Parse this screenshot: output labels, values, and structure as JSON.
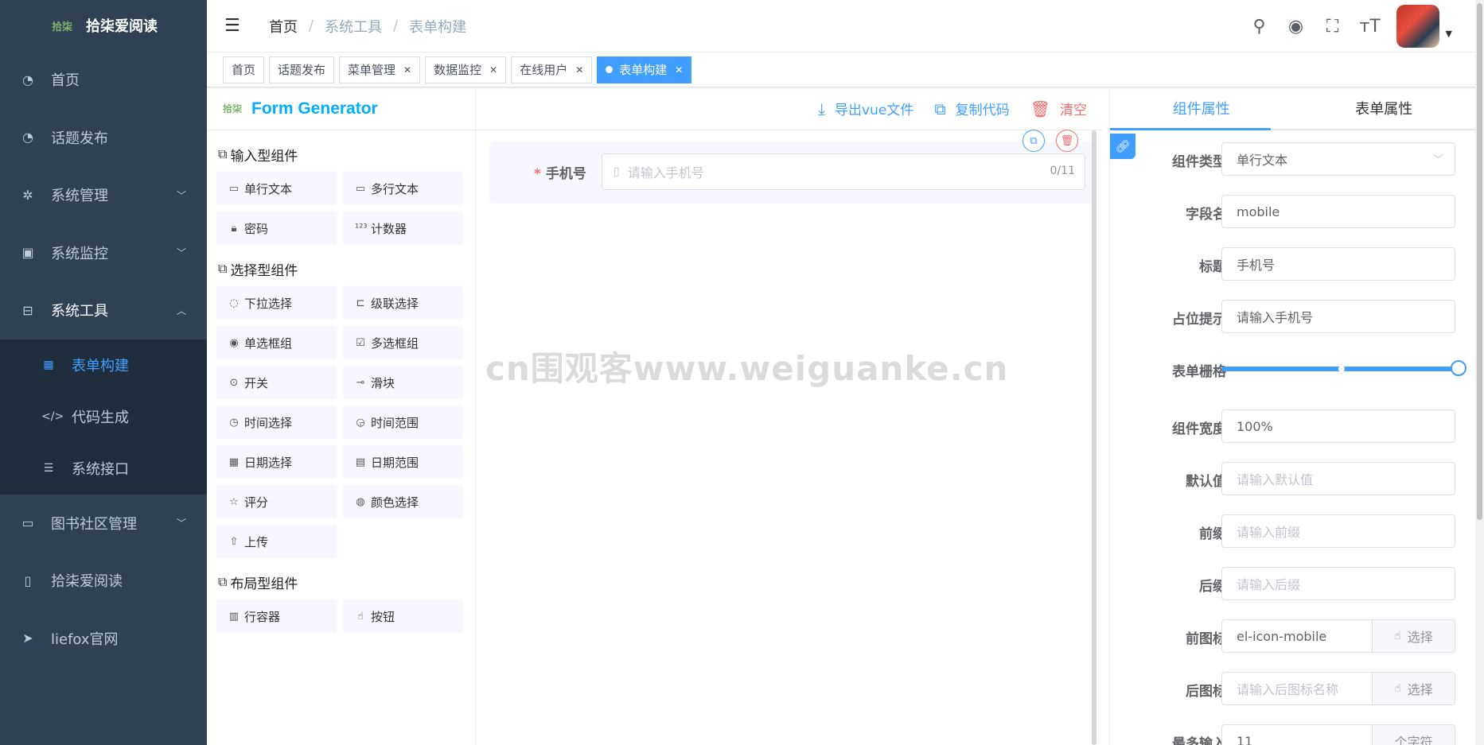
{
  "app": {
    "logo_mark": "拾柒",
    "title": "拾柒爱阅读"
  },
  "sidebar": {
    "items": [
      {
        "label": "首页",
        "icon": "dashboard-icon"
      },
      {
        "label": "话题发布",
        "icon": "dashboard-icon"
      },
      {
        "label": "系统管理",
        "icon": "gear-icon",
        "arrow": "﹀"
      },
      {
        "label": "系统监控",
        "icon": "monitor-icon",
        "arrow": "﹀"
      },
      {
        "label": "系统工具",
        "icon": "toolbox-icon",
        "arrow": "︿"
      }
    ],
    "submenu": [
      {
        "label": "表单构建",
        "icon": "table-icon",
        "active": true
      },
      {
        "label": "代码生成",
        "icon": "code-icon"
      },
      {
        "label": "系统接口",
        "icon": "sliders-icon"
      }
    ],
    "items_after": [
      {
        "label": "图书社区管理",
        "icon": "presentation-icon",
        "arrow": "﹀"
      },
      {
        "label": "拾柒爱阅读",
        "icon": "book-icon"
      },
      {
        "label": "liefox官网",
        "icon": "paper-plane-icon"
      }
    ]
  },
  "navbar": {
    "breadcrumb": [
      "首页",
      "系统工具",
      "表单构建"
    ],
    "separator": "/"
  },
  "tags": [
    {
      "label": "首页",
      "closable": false
    },
    {
      "label": "话题发布",
      "closable": false
    },
    {
      "label": "菜单管理",
      "closable": true
    },
    {
      "label": "数据监控",
      "closable": true
    },
    {
      "label": "在线用户",
      "closable": true
    },
    {
      "label": "表单构建",
      "closable": true,
      "active": true
    }
  ],
  "generator": {
    "logo": "拾柒",
    "title": "Form Generator"
  },
  "components": {
    "input_title": "输入型组件",
    "input_items": [
      {
        "label": "单行文本",
        "icon": "▭"
      },
      {
        "label": "多行文本",
        "icon": "▭"
      },
      {
        "label": "密码",
        "icon": "🔒︎"
      },
      {
        "label": "计数器",
        "icon": "¹²³"
      }
    ],
    "select_title": "选择型组件",
    "select_items": [
      {
        "label": "下拉选择",
        "icon": "◌"
      },
      {
        "label": "级联选择",
        "icon": "⊏"
      },
      {
        "label": "单选框组",
        "icon": "◉"
      },
      {
        "label": "多选框组",
        "icon": "☑"
      },
      {
        "label": "开关",
        "icon": "⊙"
      },
      {
        "label": "滑块",
        "icon": "⊸"
      },
      {
        "label": "时间选择",
        "icon": "◷"
      },
      {
        "label": "时间范围",
        "icon": "◶"
      },
      {
        "label": "日期选择",
        "icon": "▦"
      },
      {
        "label": "日期范围",
        "icon": "▤"
      },
      {
        "label": "评分",
        "icon": "☆"
      },
      {
        "label": "颜色选择",
        "icon": "◍"
      },
      {
        "label": "上传",
        "icon": "⇧"
      }
    ],
    "layout_title": "布局型组件",
    "layout_items": [
      {
        "label": "行容器",
        "icon": "▥"
      },
      {
        "label": "按钮",
        "icon": "☝"
      }
    ]
  },
  "actions": {
    "export": "导出vue文件",
    "copy": "复制代码",
    "clear": "清空"
  },
  "canvas": {
    "field_label": "手机号",
    "required_mark": "*",
    "placeholder": "请输入手机号",
    "count": "0/11"
  },
  "watermark": "cn围观客www.weiguanke.cn",
  "right_panel": {
    "tabs": [
      "组件属性",
      "表单属性"
    ],
    "props": [
      {
        "label": "组件类型",
        "value": "单行文本",
        "type": "select"
      },
      {
        "label": "字段名",
        "value": "mobile"
      },
      {
        "label": "标题",
        "value": "手机号"
      },
      {
        "label": "占位提示",
        "value": "请输入手机号"
      },
      {
        "label": "表单栅格",
        "type": "slider",
        "value": 24
      },
      {
        "label": "组件宽度",
        "value": "100%"
      },
      {
        "label": "默认值",
        "placeholder": "请输入默认值"
      },
      {
        "label": "前缀",
        "placeholder": "请输入前缀"
      },
      {
        "label": "后缀",
        "placeholder": "请输入后缀"
      },
      {
        "label": "前图标",
        "value": "el-icon-mobile",
        "append": "选择"
      },
      {
        "label": "后图标",
        "placeholder": "请输入后图标名称",
        "append": "选择"
      },
      {
        "label": "最多输入",
        "value": "11",
        "append": "个字符"
      }
    ]
  },
  "colors": {
    "sidebar_bg": "#304156",
    "submenu_bg": "#1f2d3d",
    "primary": "#409eff",
    "danger": "#f56c6c"
  }
}
